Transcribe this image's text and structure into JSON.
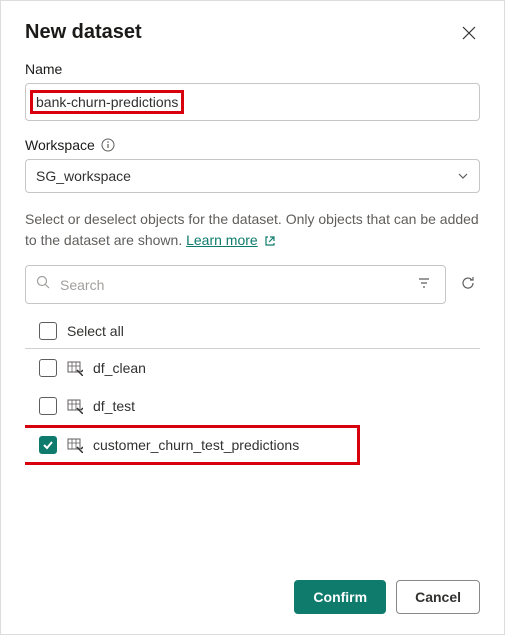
{
  "dialog": {
    "title": "New dataset",
    "close": "✕"
  },
  "name_field": {
    "label": "Name",
    "value": "bank-churn-predictions"
  },
  "workspace_field": {
    "label": "Workspace",
    "value": "SG_workspace"
  },
  "helper": {
    "text_part1": "Select or deselect objects for the dataset. Only objects that can be added to the dataset are shown. ",
    "learn_more": "Learn more "
  },
  "search": {
    "placeholder": "Search"
  },
  "select_all_label": "Select all",
  "items": [
    {
      "label": "df_clean",
      "checked": false
    },
    {
      "label": "df_test",
      "checked": false
    },
    {
      "label": "customer_churn_test_predictions",
      "checked": true
    }
  ],
  "actions": {
    "confirm": "Confirm",
    "cancel": "Cancel"
  }
}
